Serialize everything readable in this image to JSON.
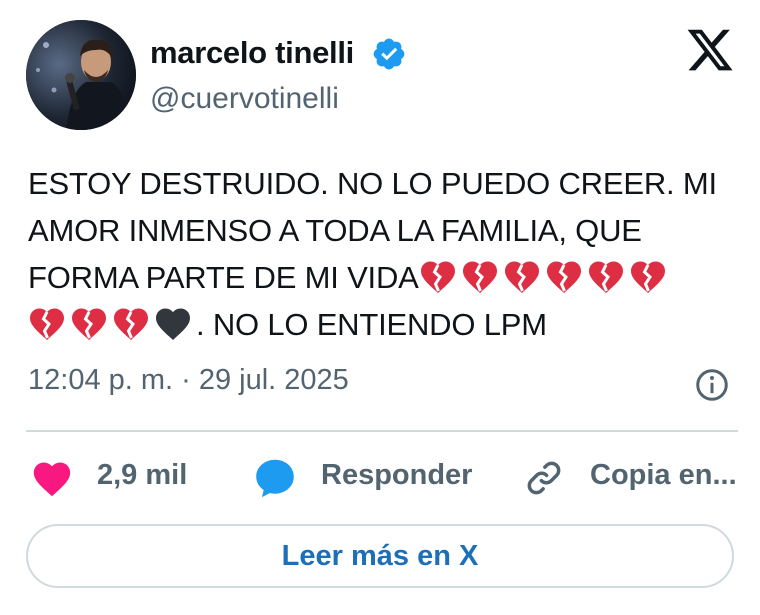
{
  "author": {
    "name": "marcelo tinelli",
    "handle": "@cuervotinelli",
    "verified": true
  },
  "tweet": {
    "line1": "ESTOY DESTRUIDO. NO LO PUEDO CREER. MI",
    "line2": "AMOR INMENSO A TODA LA FAMILIA, QUE",
    "line3": "FORMA PARTE DE MI VIDA",
    "line4_suffix": ". NO LO ENTIENDO LPM",
    "emojis_line3": [
      "broken-heart",
      "broken-heart",
      "broken-heart",
      "broken-heart",
      "broken-heart",
      "broken-heart"
    ],
    "emojis_line4": [
      "broken-heart",
      "broken-heart",
      "broken-heart",
      "black-heart"
    ]
  },
  "meta": {
    "timestamp": "12:04 p. m. · 29 jul. 2025"
  },
  "actions": {
    "likes": "2,9 mil",
    "reply": "Responder",
    "copy": "Copia en..."
  },
  "read_more": "Leer más en X",
  "icons": {
    "verified": "verified-badge-icon",
    "logo": "x-logo-icon",
    "info": "info-icon",
    "like": "heart-icon",
    "reply": "speech-bubble-icon",
    "copy": "link-icon"
  },
  "colors": {
    "accent": "#1d9bf0",
    "like": "#f91880",
    "text": "#0f1419",
    "muted": "#536471",
    "broken_heart": "#dd2e44",
    "black_heart": "#31373d"
  }
}
